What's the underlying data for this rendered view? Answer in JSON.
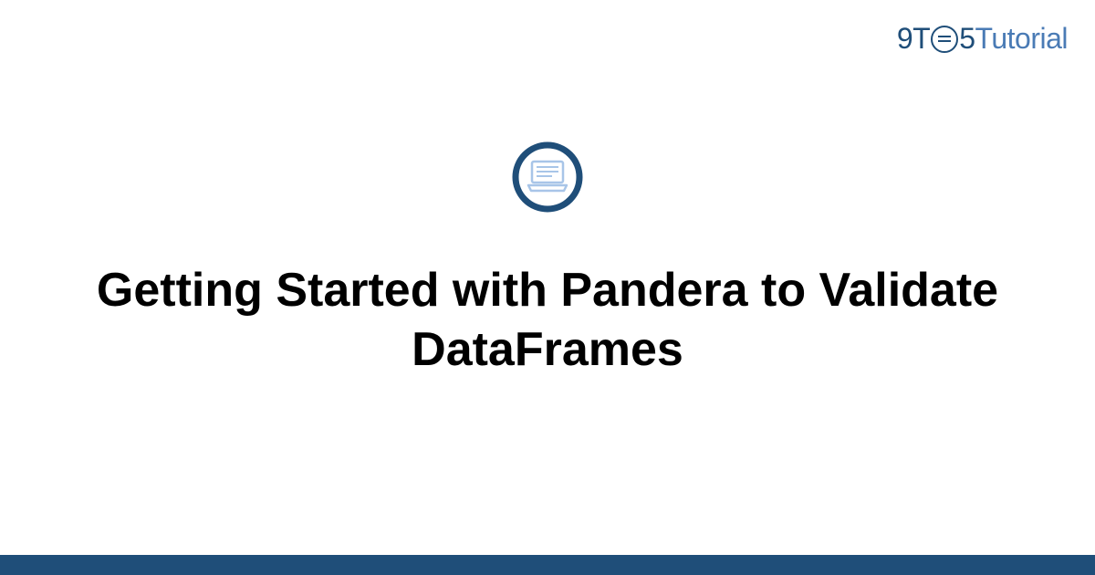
{
  "logo": {
    "part1": "9T",
    "part2": "5",
    "part3": "Tutorial"
  },
  "title": "Getting Started with Pandera to Validate DataFrames",
  "colors": {
    "primary": "#1f4e79",
    "secondary": "#4a7bb5",
    "iconLight": "#a8c5e8"
  },
  "icon": "laptop-document-icon"
}
